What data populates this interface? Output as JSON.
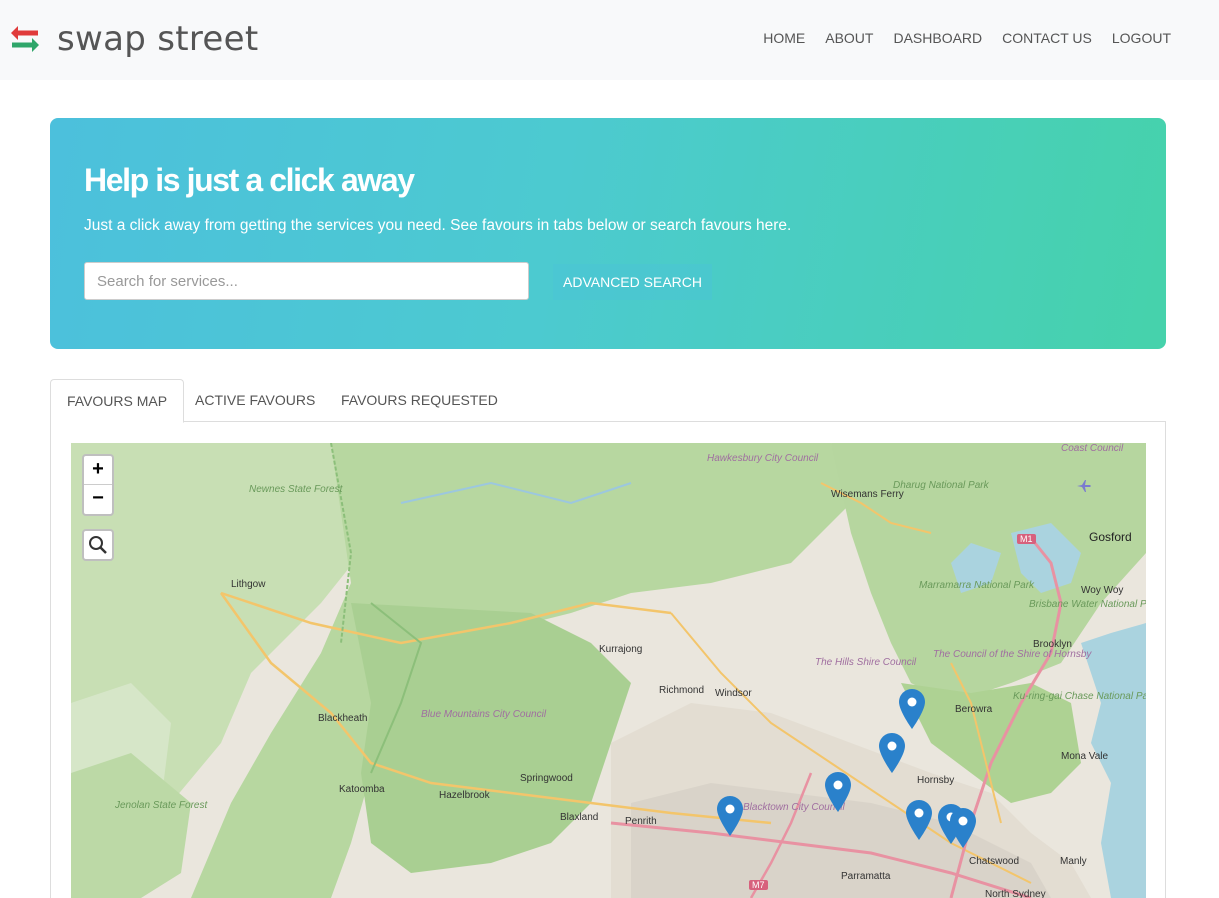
{
  "brand": {
    "name": "swap street",
    "logo_icon": "swap-arrows-icon",
    "colors": {
      "red": "#e03b3b",
      "green": "#2fa66a"
    }
  },
  "nav": {
    "items": [
      {
        "label": "HOME"
      },
      {
        "label": "ABOUT"
      },
      {
        "label": "DASHBOARD"
      },
      {
        "label": "CONTACT US"
      },
      {
        "label": "LOGOUT"
      }
    ]
  },
  "hero": {
    "title": "Help is just a click away",
    "subtitle": "Just a click away from getting the services you need. See favours in tabs below or search favours here.",
    "search_placeholder": "Search for services...",
    "search_value": "",
    "advanced_label": "ADVANCED SEARCH",
    "gradient": [
      "#4cc0dc",
      "#46d2ab"
    ]
  },
  "tabs": [
    {
      "label": "FAVOURS MAP",
      "active": true
    },
    {
      "label": "ACTIVE FAVOURS",
      "active": false
    },
    {
      "label": "FAVOURS REQUESTED",
      "active": false
    }
  ],
  "map": {
    "zoom_in": "+",
    "zoom_out": "−",
    "search_icon": "magnifier-icon",
    "marker_color": "#2a81cb",
    "marker_count": 7,
    "labels": {
      "hawkesbury": "Hawkesbury City Council",
      "newnes": "Newnes State Forest",
      "wisemans": "Wisemans Ferry",
      "dharug": "Dharug National Park",
      "gosford": "Gosford",
      "m1": "M1",
      "lithgow": "Lithgow",
      "marramarra": "Marramarra National Park",
      "woywoy": "Woy Woy",
      "brisbane_water": "Brisbane Water National Park",
      "kurrajong": "Kurrajong",
      "hills": "The Hills Shire Council",
      "hornsby_council": "The Council of the Shire of Hornsby",
      "brooklyn": "Brooklyn",
      "richmond": "Richmond",
      "windsor": "Windsor",
      "blackheath": "Blackheath",
      "blue_mountains": "Blue Mountains City Council",
      "berowra": "Berowra",
      "kuringgai": "Ku-ring-gai Chase National Park",
      "mona_vale": "Mona Vale",
      "springwood": "Springwood",
      "katoomba": "Katoomba",
      "hazelbrook": "Hazelbrook",
      "hornsby": "Hornsby",
      "jenolan": "Jenolan State Forest",
      "blaxland": "Blaxland",
      "penrith": "Penrith",
      "blacktown": "Blacktown City Council",
      "chatswood": "Chatswood",
      "manly": "Manly",
      "m7": "M7",
      "parramatta": "Parramatta",
      "north_sydney": "North Sydney",
      "coast_council": "Coast Council"
    }
  }
}
